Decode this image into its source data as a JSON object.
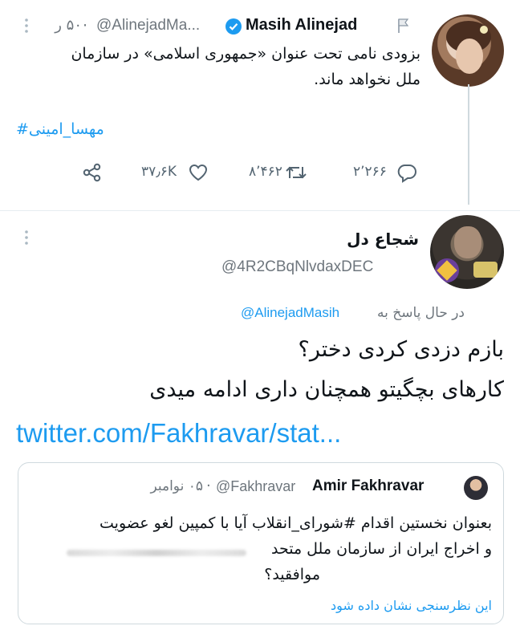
{
  "tweet1": {
    "author_name": "Masih Alinejad",
    "handle": "@AlinejadMa...",
    "time": "۵۰ ر",
    "text_line1": "بزودی نامی تحت عنوان «جمهوری اسلامی» در سازمان",
    "text_line2": "ملل نخواهد ماند.",
    "hashtag": "#مهسا_امینی",
    "replies": "۲٬۲۶۶",
    "retweets": "۸٬۴۶۲",
    "likes": "۳۷٫۶K"
  },
  "tweet2": {
    "author_name": "شجاع دل",
    "handle": "@4R2CBqNlvdaxDEC",
    "replying_label": "در حال پاسخ به",
    "replying_to": "@AlinejadMasih",
    "text_line1": "بازم دزدی کردی دختر؟",
    "text_line2": "کارهای بچگیتو همچنان داری ادامه میدی",
    "link": "twitter.com/Fakhravar/stat..."
  },
  "quoted": {
    "author_name": "Amir Fakhravar",
    "handle": "@Fakhravar",
    "time": "۰۵ نوامبر",
    "text_line1": "بعنوان نخستین اقدام #شورای_انقلاب آیا با کمپین لغو عضویت",
    "text_line2": "و اخراج ایران از سازمان ملل متحد",
    "text_line3": "موافقید؟",
    "poll_link": "این نظرسنجی نشان داده شود"
  },
  "colors": {
    "accent": "#1d9bf0",
    "text": "#0f1419",
    "muted": "#6e767d"
  },
  "icons": [
    "flag-icon",
    "verified-icon",
    "reply-icon",
    "retweet-icon",
    "like-icon",
    "share-icon",
    "more-icon"
  ]
}
